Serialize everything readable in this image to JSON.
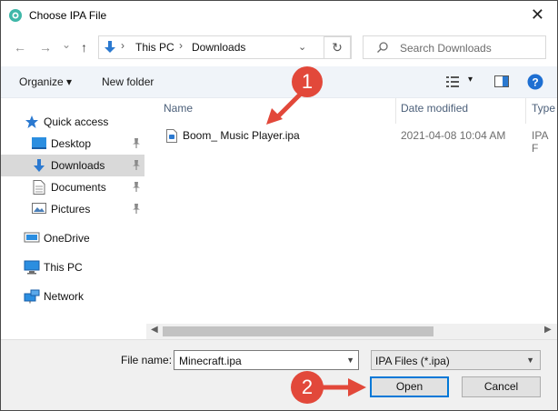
{
  "window": {
    "title": "Choose IPA File",
    "close_glyph": "✕"
  },
  "nav": {
    "back": "←",
    "forward": "→",
    "recent": "⌄",
    "up": "↑",
    "refresh": "↻"
  },
  "address": {
    "crumbs": [
      "This PC",
      "Downloads"
    ],
    "separator": "›",
    "dropdown": "⌄"
  },
  "search": {
    "placeholder": "Search Downloads"
  },
  "toolbar": {
    "organize": "Organize ▾",
    "new_folder": "New folder",
    "view_dropdown": "▾"
  },
  "sidebar": {
    "items": [
      {
        "label": "Quick access",
        "icon": "star-icon"
      },
      {
        "label": "Desktop",
        "icon": "desktop-icon",
        "pinned": true
      },
      {
        "label": "Downloads",
        "icon": "download-icon",
        "pinned": true,
        "selected": true
      },
      {
        "label": "Documents",
        "icon": "document-icon",
        "pinned": true
      },
      {
        "label": "Pictures",
        "icon": "pictures-icon",
        "pinned": true
      },
      {
        "label": "OneDrive",
        "icon": "cloud-icon"
      },
      {
        "label": "This PC",
        "icon": "computer-icon"
      },
      {
        "label": "Network",
        "icon": "network-icon"
      }
    ]
  },
  "columns": {
    "name": "Name",
    "date_modified": "Date modified",
    "type": "Type"
  },
  "files": [
    {
      "name": "Boom_ Music Player.ipa",
      "date": "2021-04-08 10:04 AM",
      "type": "IPA F"
    }
  ],
  "bottom": {
    "file_name_label": "File name:",
    "file_name_value": "Minecraft.ipa",
    "file_type_value": "IPA Files (*.ipa)",
    "open_label": "Open",
    "cancel_label": "Cancel"
  },
  "annotations": {
    "step1": "1",
    "step2": "2"
  },
  "colors": {
    "accent": "#0078d7",
    "callout": "#e2483a",
    "selected": "#d9d9d9"
  }
}
